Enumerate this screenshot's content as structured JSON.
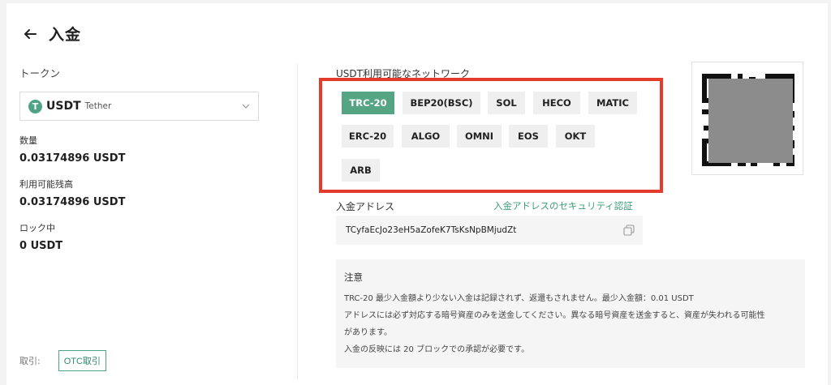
{
  "header": {
    "title": "入金",
    "back_icon": "arrow-left-icon"
  },
  "token": {
    "label": "トークン",
    "symbol": "USDT",
    "name": "Tether",
    "icon_letter": "T",
    "icon_color": "#4fa488"
  },
  "stats": [
    {
      "label": "数量",
      "value": "0.03174896 USDT"
    },
    {
      "label": "利用可能残高",
      "value": "0.03174896 USDT"
    },
    {
      "label": "ロック中",
      "value": "0 USDT"
    }
  ],
  "footer": {
    "label": "取引:",
    "otc_label": "OTC取引"
  },
  "network": {
    "title": "USDT利用可能なネットワーク",
    "selected": "TRC-20",
    "highlight_color": "#e43b2c",
    "active_color": "#55a585",
    "chips": [
      "TRC-20",
      "BEP20(BSC)",
      "SOL",
      "HECO",
      "MATIC",
      "ERC-20",
      "ALGO",
      "OMNI",
      "EOS",
      "OKT",
      "ARB"
    ]
  },
  "address": {
    "title": "入金アドレス",
    "verify_link": "入金アドレスのセキュリティ認証",
    "value": "TCyfaEcJo23eH5aZofeK7TsKsNpBMjudZt",
    "copy_icon": "copy-icon"
  },
  "note": {
    "title": "注意",
    "lines": [
      "TRC-20 最少入金額より少ない入金は記録されず、返還もされません。最少入金額：0.01 USDT",
      "アドレスには必ず対応する暗号資産のみを送金してください。異なる暗号資産を送金すると、資産が失われる可能性",
      "があります。",
      "入金の反映には 20 ブロックでの承認が必要です。"
    ]
  }
}
